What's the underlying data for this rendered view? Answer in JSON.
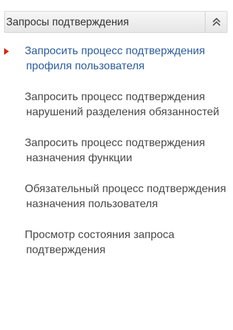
{
  "panel": {
    "title": "Запросы подтверждения",
    "collapse_icon": "double-chevron-up-icon",
    "active_marker_color": "#d42a14",
    "active_link_color": "#2b5b9b",
    "items": [
      {
        "label": "Запросить процесс подтверждения профиля пользователя",
        "active": true
      },
      {
        "label": "Запросить процесс подтверждения нарушений разделения обязанностей",
        "active": false
      },
      {
        "label": "Запросить процесс подтверждения назначения функции",
        "active": false
      },
      {
        "label": "Обязательный процесс подтверждения назначения пользователя",
        "active": false
      },
      {
        "label": "Просмотр состояния запроса подтверждения",
        "active": false
      }
    ]
  }
}
